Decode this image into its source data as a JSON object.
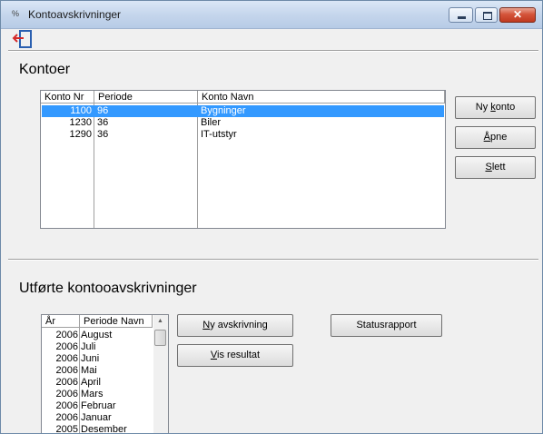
{
  "window": {
    "title": "Kontoavskrivninger",
    "app_icon_glyph": "%",
    "minimize_icon": "minimize-icon",
    "maximize_icon": "maximize-icon",
    "close_glyph": "✕"
  },
  "toolbar": {
    "exit_icon": "exit-door-icon"
  },
  "accounts": {
    "heading": "Kontoer",
    "columns": [
      "Konto Nr",
      "Periode",
      "Konto Navn"
    ],
    "rows": [
      {
        "nr": "1100",
        "periode": "96",
        "navn": "Bygninger",
        "selected": true
      },
      {
        "nr": "1230",
        "periode": "36",
        "navn": "Biler",
        "selected": false
      },
      {
        "nr": "1290",
        "periode": "36",
        "navn": "IT-utstyr",
        "selected": false
      }
    ],
    "buttons": {
      "new": {
        "pre": "Ny ",
        "ul": "k",
        "post": "onto"
      },
      "open": {
        "pre": "",
        "ul": "Å",
        "post": "pne"
      },
      "delete": {
        "pre": "",
        "ul": "S",
        "post": "lett"
      }
    }
  },
  "depreciations": {
    "heading": "Utførte kontooavskrivninger",
    "columns": [
      "År",
      "Periode Navn"
    ],
    "rows": [
      {
        "year": "2006",
        "period": "August"
      },
      {
        "year": "2006",
        "period": "Juli"
      },
      {
        "year": "2006",
        "period": "Juni"
      },
      {
        "year": "2006",
        "period": "Mai"
      },
      {
        "year": "2006",
        "period": "April"
      },
      {
        "year": "2006",
        "period": "Mars"
      },
      {
        "year": "2006",
        "period": "Februar"
      },
      {
        "year": "2006",
        "period": "Januar"
      },
      {
        "year": "2005",
        "period": "Desember"
      }
    ],
    "buttons": {
      "new": {
        "pre": "",
        "ul": "N",
        "post": "y avskrivning"
      },
      "result": {
        "pre": "",
        "ul": "V",
        "post": "is resultat"
      },
      "status": {
        "pre": "Statusrapport",
        "ul": "",
        "post": ""
      }
    },
    "scroll_up_glyph": "▲"
  },
  "colors": {
    "selection": "#3399ff",
    "close_button": "#c0391f",
    "exit_icon_arrow": "#d42a2a",
    "exit_icon_door": "#2a5fb0"
  }
}
